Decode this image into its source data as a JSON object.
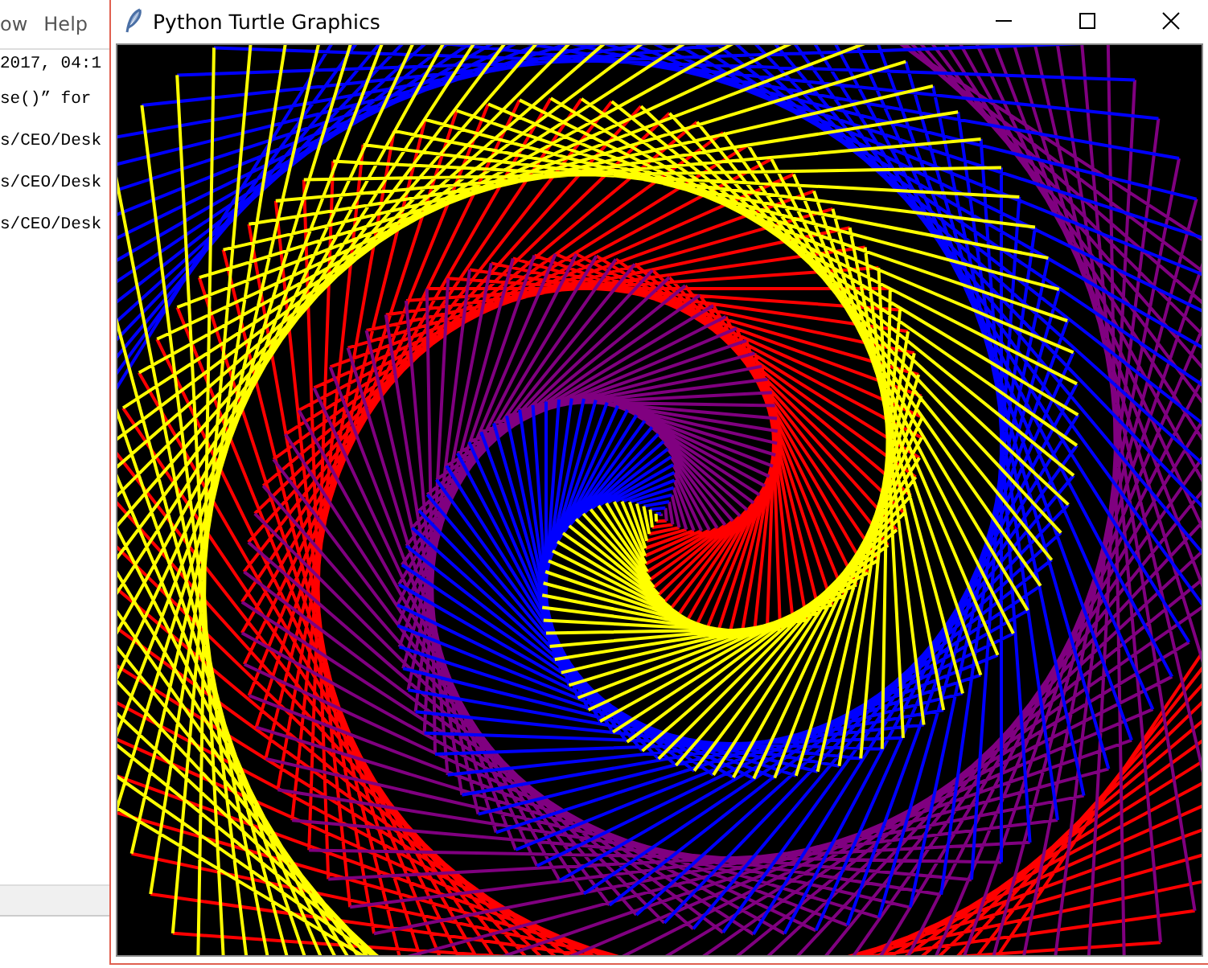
{
  "background_window": {
    "menu": [
      "ow",
      "Help"
    ],
    "shell_lines": [
      "2017, 04:1",
      "se()” for",
      "s/CEO/Desk",
      "s/CEO/Desk",
      "s/CEO/Desk"
    ]
  },
  "turtle_window": {
    "title": "Python Turtle Graphics"
  }
}
